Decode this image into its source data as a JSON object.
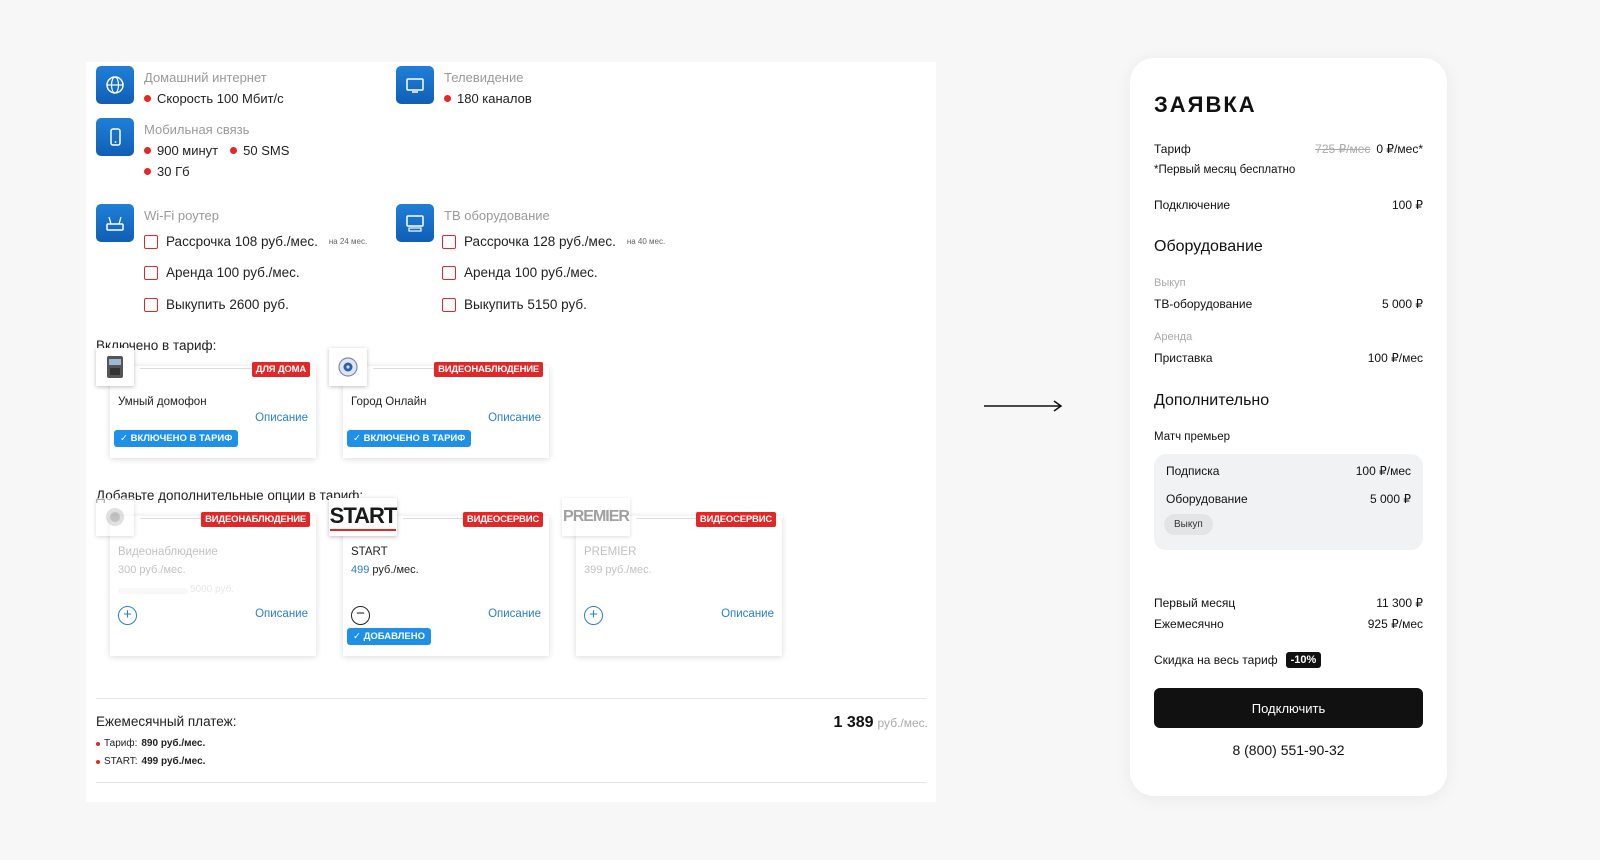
{
  "services": {
    "internet": {
      "title": "Домашний интернет",
      "speed": "Скорость 100 Мбит/с"
    },
    "tv": {
      "title": "Телевидение",
      "channels": "180 каналов"
    },
    "mobile": {
      "title": "Мобильная связь",
      "minutes": "900 минут",
      "sms": "50 SMS",
      "data": "30 Гб"
    },
    "router": {
      "title": "Wi-Fi роутер",
      "installment": "Рассрочка 108 руб./мес.",
      "installment_note": "на 24 мес.",
      "rent": "Аренда 100 руб./мес.",
      "buy": "Выкупить 2600 руб."
    },
    "tv_equipment": {
      "title": "ТВ оборудование",
      "installment": "Рассрочка 128 руб./мес.",
      "installment_note": "на 40 мес.",
      "rent": "Аренда 100 руб./мес.",
      "buy": "Выкупить 5150 руб."
    }
  },
  "included": {
    "heading": "Включено в тариф:",
    "cards": [
      {
        "name": "Умный домофон",
        "tag": "ДЛЯ ДОМА",
        "desc": "Описание",
        "badge": "ВКЛЮЧЕНО В ТАРИФ",
        "icon": "intercom-icon"
      },
      {
        "name": "Город Онлайн",
        "tag": "ВИДЕОНАБЛЮДЕНИЕ",
        "desc": "Описание",
        "badge": "ВКЛЮЧЕНО В ТАРИФ",
        "icon": "camera-icon"
      }
    ]
  },
  "options": {
    "heading": "Добавьте дополнительные опции в тариф:",
    "cards": [
      {
        "name": "Видеонаблюдение",
        "tag": "ВИДЕОНАБЛЮДЕНИЕ",
        "price": "300 руб./мес.",
        "extra": "5000 руб.",
        "desc": "Описание"
      },
      {
        "name": "START",
        "logo": "START",
        "tag": "ВИДЕОСЕРВИС",
        "price_value": "499",
        "price_unit": "руб./мес.",
        "desc": "Описание",
        "badge": "ДОБАВЛЕНО"
      },
      {
        "name": "PREMIER",
        "logo": "PREMIER",
        "tag": "ВИДЕОСЕРВИС",
        "price": "399 руб./мес.",
        "desc": "Описание"
      }
    ]
  },
  "monthly": {
    "heading": "Ежемесячный платеж:",
    "total": "1 389",
    "unit": "руб./мес.",
    "lines": [
      {
        "label": "Тариф:",
        "value": "890 руб./мес."
      },
      {
        "label": "START:",
        "value": "499 руб./мес."
      }
    ]
  },
  "order": {
    "title": "ЗАЯВКА",
    "tariff_label": "Тариф",
    "tariff_old": "725 ₽/мес",
    "tariff_new": "0 ₽/мес*",
    "free_note": "*Первый месяц бесплатно",
    "connection_label": "Подключение",
    "connection_value": "100 ₽",
    "equipment_heading": "Оборудование",
    "buyout_label": "Выкуп",
    "tv_equipment_label": "ТВ-оборудование",
    "tv_equipment_value": "5 000 ₽",
    "rent_label": "Аренда",
    "settop_label": "Приставка",
    "settop_value": "100 ₽/мес",
    "extra_heading": "Дополнительно",
    "match_label": "Матч премьер",
    "subscription_label": "Подписка",
    "subscription_value": "100 ₽/мес",
    "match_equipment_label": "Оборудование",
    "match_equipment_value": "5 000 ₽",
    "match_pill": "Выкуп",
    "first_month_label": "Первый месяц",
    "first_month_value": "11 300 ₽",
    "monthly_label": "Ежемесячно",
    "monthly_value": "925 ₽/мес",
    "discount_label": "Скидка на весь тариф",
    "discount_value": "-10%",
    "connect_button": "Подключить",
    "phone": "8 (800) 551-90-32"
  }
}
